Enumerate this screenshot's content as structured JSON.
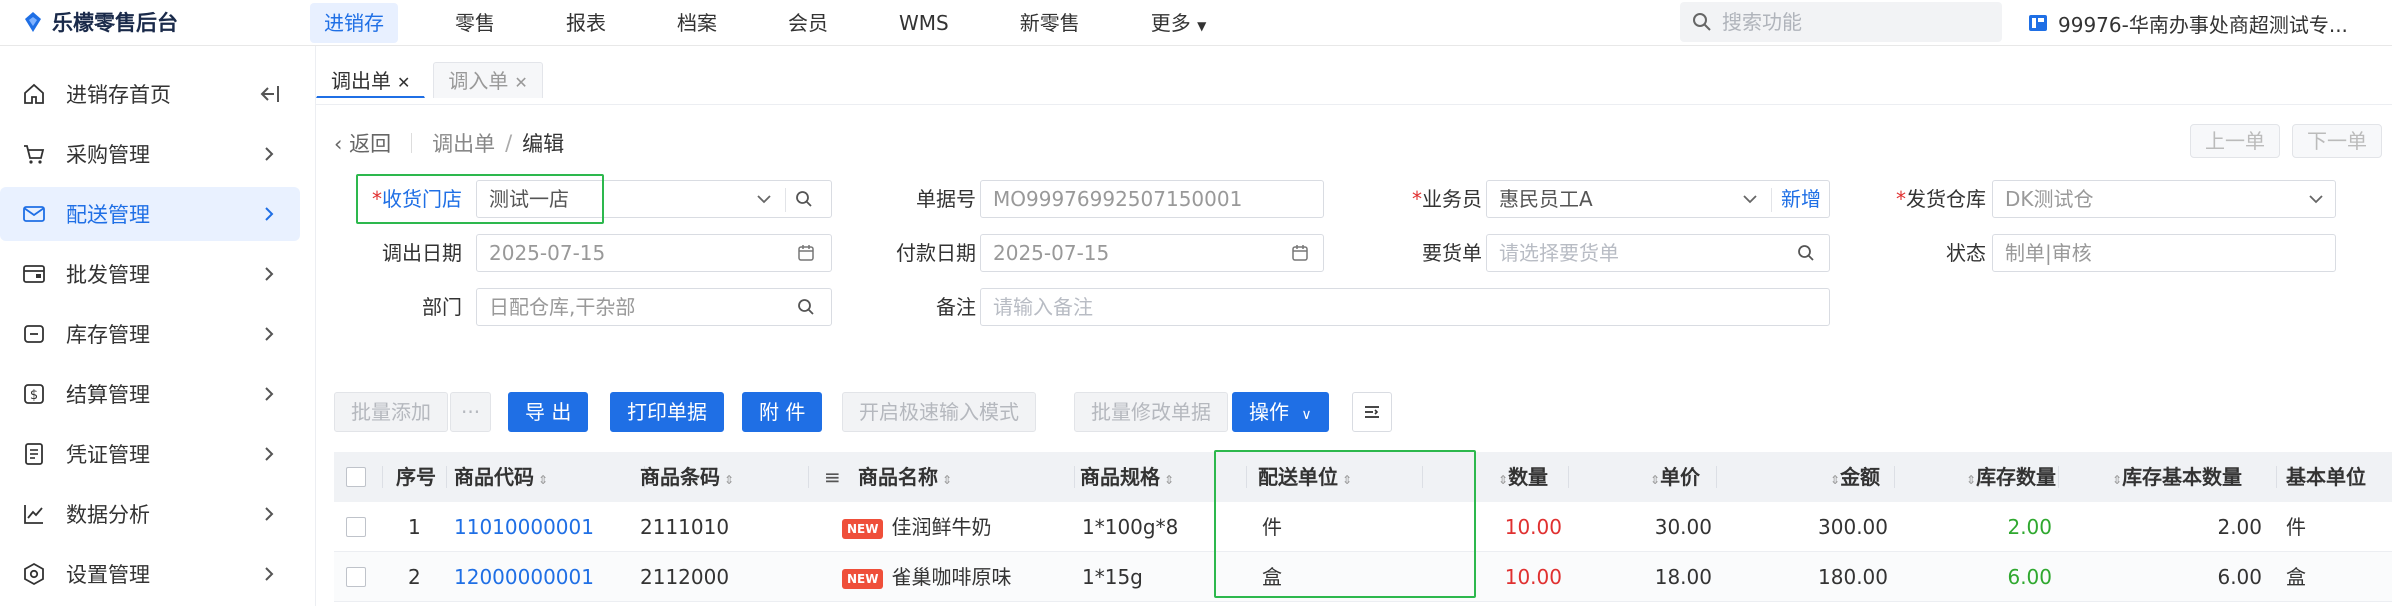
{
  "app": {
    "title": "乐檬零售后台"
  },
  "topnav": {
    "items": [
      "进销存",
      "零售",
      "报表",
      "档案",
      "会员",
      "WMS",
      "新零售",
      "更多"
    ],
    "active_index": 0
  },
  "search": {
    "placeholder": "搜索功能"
  },
  "store": {
    "name": "99976-华南办事处商超测试专..."
  },
  "sidebar": {
    "collapse_label": "",
    "items": [
      {
        "label": "进销存首页",
        "icon": "home-icon"
      },
      {
        "label": "采购管理",
        "icon": "cart-icon"
      },
      {
        "label": "配送管理",
        "icon": "delivery-icon",
        "active": true
      },
      {
        "label": "批发管理",
        "icon": "wallet-icon"
      },
      {
        "label": "库存管理",
        "icon": "inventory-icon"
      },
      {
        "label": "结算管理",
        "icon": "dollar-icon"
      },
      {
        "label": "凭证管理",
        "icon": "voucher-icon"
      },
      {
        "label": "数据分析",
        "icon": "chart-icon"
      },
      {
        "label": "设置管理",
        "icon": "settings-icon"
      }
    ]
  },
  "tabs": [
    {
      "label": "调出单",
      "active": true
    },
    {
      "label": "调入单",
      "active": false
    }
  ],
  "breadcrumb": {
    "back": "返回",
    "parent": "调出单",
    "sep": "/",
    "current": "编辑"
  },
  "pager": {
    "prev": "上一单",
    "next": "下一单"
  },
  "form": {
    "receive_store": {
      "label": "收货门店",
      "value": "测试一店"
    },
    "doc_no": {
      "label": "单据号",
      "value": "MO99976992507150001"
    },
    "salesman": {
      "label": "业务员",
      "value": "惠民员工A",
      "add": "新增"
    },
    "ship_warehouse": {
      "label": "发货仓库",
      "value": "DK测试仓"
    },
    "out_date": {
      "label": "调出日期",
      "value": "2025-07-15"
    },
    "pay_date": {
      "label": "付款日期",
      "value": "2025-07-15"
    },
    "request_doc": {
      "label": "要货单",
      "placeholder": "请选择要货单"
    },
    "status": {
      "label": "状态",
      "value": "制单|审核"
    },
    "dept": {
      "label": "部门",
      "value": "日配仓库,干杂部"
    },
    "remark": {
      "label": "备注",
      "placeholder": "请输入备注"
    }
  },
  "toolbar": {
    "batch_add": "批量添加",
    "more": "···",
    "export": "导 出",
    "print": "打印单据",
    "attach": "附 件",
    "fast_input": "开启极速输入模式",
    "batch_edit": "批量修改单据",
    "ops": "操作"
  },
  "table": {
    "headers": {
      "seq": "序号",
      "code": "商品代码",
      "barcode": "商品条码",
      "name": "商品名称",
      "spec": "商品规格",
      "unit": "配送单位",
      "qty": "数量",
      "price": "单价",
      "amount": "金额",
      "stock_qty": "库存数量",
      "stock_base_qty": "库存基本数量",
      "base_unit": "基本单位"
    },
    "rows": [
      {
        "seq": "1",
        "code": "11010000001",
        "barcode": "2111010",
        "tag": "NEW",
        "name": "佳润鲜牛奶",
        "spec": "1*100g*8",
        "unit": "件",
        "qty": "10.00",
        "price": "30.00",
        "amount": "300.00",
        "stock_qty": "2.00",
        "stock_base_qty": "2.00",
        "base_unit": "件"
      },
      {
        "seq": "2",
        "code": "12000000001",
        "barcode": "2112000",
        "tag": "NEW",
        "name": "雀巢咖啡原味",
        "spec": "1*15g",
        "unit": "盒",
        "qty": "10.00",
        "price": "18.00",
        "amount": "180.00",
        "stock_qty": "6.00",
        "stock_base_qty": "6.00",
        "base_unit": "盒"
      }
    ]
  },
  "colors": {
    "accent": "#1f6fe5",
    "required": "#e03030",
    "highlight_box": "#2db84d",
    "stock_green": "#2fa82f"
  }
}
